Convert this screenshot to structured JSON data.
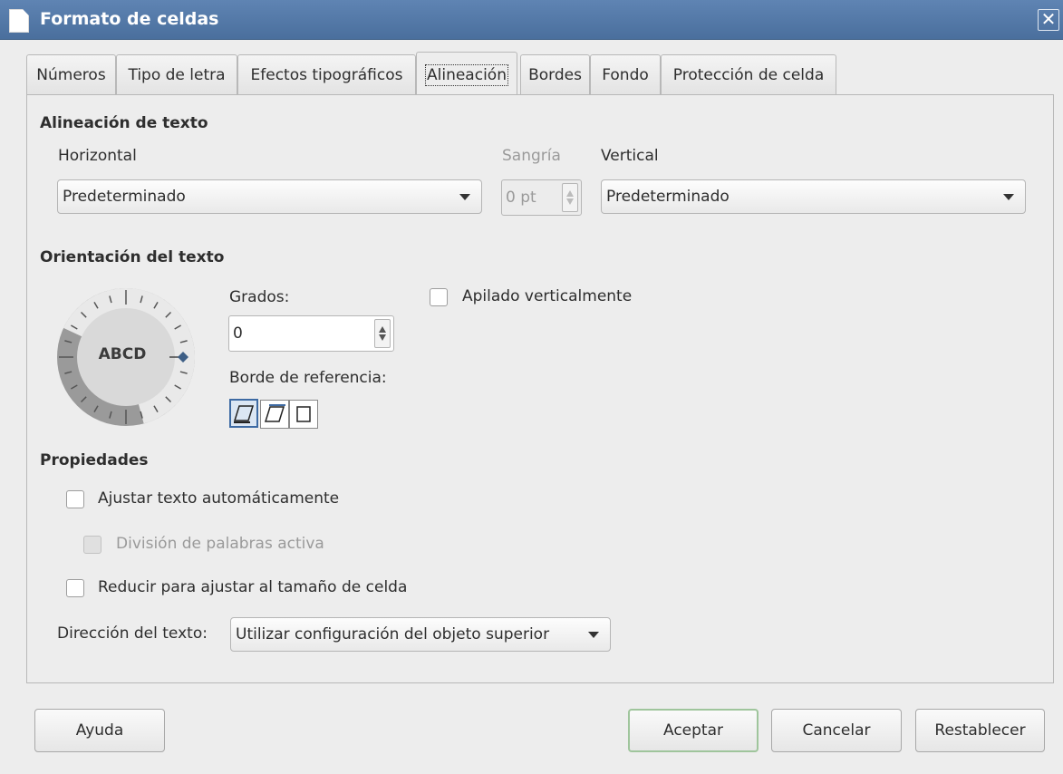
{
  "window": {
    "title": "Formato de celdas",
    "close_glyph": "✕"
  },
  "tabs": [
    {
      "label": "Números"
    },
    {
      "label": "Tipo de letra"
    },
    {
      "label": "Efectos tipográficos"
    },
    {
      "label": "Alineación",
      "active": true
    },
    {
      "label": "Bordes"
    },
    {
      "label": "Fondo"
    },
    {
      "label": "Protección de celda"
    }
  ],
  "text_alignment": {
    "title": "Alineación de texto",
    "horizontal_label": "Horizontal",
    "horizontal_value": "Predeterminado",
    "indent_label": "Sangría",
    "indent_value": "0 pt",
    "vertical_label": "Vertical",
    "vertical_value": "Predeterminado"
  },
  "orientation": {
    "title": "Orientación del texto",
    "dial_text": "ABCD",
    "degrees_label": "Grados:",
    "degrees_value": "0",
    "reference_edge_label": "Borde de referencia:",
    "stacked_label": "Apilado verticalmente"
  },
  "properties": {
    "title": "Propiedades",
    "wrap_label": "Ajustar texto automáticamente",
    "hyphenation_label": "División de palabras activa",
    "shrink_label": "Reducir para ajustar al tamaño de celda",
    "direction_label": "Dirección del texto:",
    "direction_value": "Utilizar configuración del objeto superior"
  },
  "buttons": {
    "help": "Ayuda",
    "ok": "Aceptar",
    "cancel": "Cancelar",
    "reset": "Restablecer"
  },
  "icons": {
    "title": "document-icon",
    "close": "close-icon",
    "dropdown": "chevron-down-icon",
    "spin": "spin-arrows-icon"
  },
  "colors": {
    "titlebar": "#4f74a3",
    "selection": "#3d6aa3",
    "default_button_border": "#9fc59c"
  }
}
